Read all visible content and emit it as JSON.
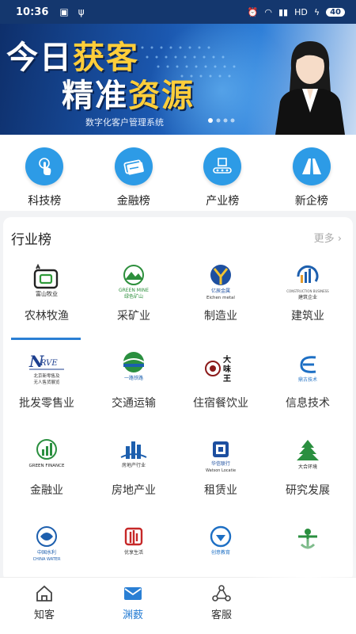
{
  "status_bar": {
    "time": "10:36",
    "network": "HD",
    "battery": "40"
  },
  "banner": {
    "line1_a": "今日",
    "line1_b": "获客",
    "line2_a": "精准",
    "line2_b": "资源",
    "subtitle": "数字化客户管理系统"
  },
  "quick_nav": [
    {
      "label": "科技榜",
      "icon": "tap-finger-icon"
    },
    {
      "label": "金融榜",
      "icon": "bank-card-icon"
    },
    {
      "label": "产业榜",
      "icon": "conveyor-icon"
    },
    {
      "label": "新企榜",
      "icon": "road-icon"
    }
  ],
  "industry": {
    "title": "行业榜",
    "more": "更多 ›",
    "items": [
      {
        "label": "农林牧渔",
        "logo_text": "富山牧业"
      },
      {
        "label": "采矿业",
        "logo_text": "GREEN MINE 绿色矿山"
      },
      {
        "label": "制造业",
        "logo_text": "亿辰金属 Eichen metal"
      },
      {
        "label": "建筑业",
        "logo_text": "建筑企业"
      },
      {
        "label": "批发零售业",
        "logo_text": "NRVE 北京新零售及无人售货展览"
      },
      {
        "label": "交通运输",
        "logo_text": "一路铁路"
      },
      {
        "label": "住宿餐饮业",
        "logo_text": "大味王"
      },
      {
        "label": "信息技术",
        "logo_text": "鼎古技术"
      },
      {
        "label": "金融业",
        "logo_text": "GREEN FINANCE"
      },
      {
        "label": "房地产业",
        "logo_text": "房地产行业"
      },
      {
        "label": "租赁业",
        "logo_text": "华信联行 Watson Locatie"
      },
      {
        "label": "研究发展",
        "logo_text": "大合环境"
      },
      {
        "label": "",
        "logo_text": "中国水利 CHINA WATER"
      },
      {
        "label": "",
        "logo_text": "优享生活"
      },
      {
        "label": "",
        "logo_text": "创意教育"
      },
      {
        "label": "",
        "logo_text": ""
      }
    ]
  },
  "tabs": [
    {
      "label": "知客",
      "icon": "home-icon"
    },
    {
      "label": "渊薮",
      "icon": "mail-icon"
    },
    {
      "label": "客服",
      "icon": "share-icon"
    }
  ],
  "colors": {
    "accent": "#2a7fd4",
    "nav_circle": "#2d9be6",
    "banner_dark": "#0e2f6b"
  }
}
